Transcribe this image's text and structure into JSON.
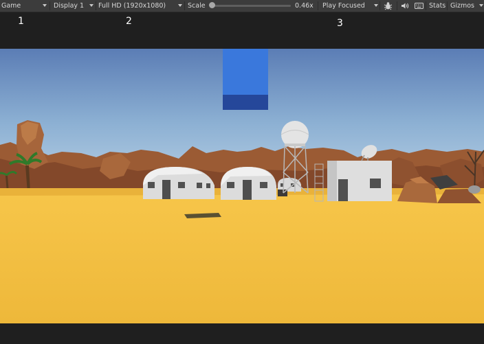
{
  "toolbar": {
    "view_label": "Game",
    "display_label": "Display 1",
    "resolution_label": "Full HD (1920x1080)",
    "scale_label": "Scale",
    "scale_value_text": "0.46x",
    "scale_value": 0.46,
    "play_mode_label": "Play Focused",
    "stats_label": "Stats",
    "gizmos_label": "Gizmos"
  },
  "annotations": [
    "1",
    "2",
    "3"
  ],
  "colors": {
    "toolbar_bg": "#3c3c3c",
    "letterbox": "#1f1f1f",
    "sky_top": "#5b7db5",
    "sand": "#f1bd3a",
    "rock": "#9b5b34",
    "cube_blue": "#3a78dc"
  }
}
